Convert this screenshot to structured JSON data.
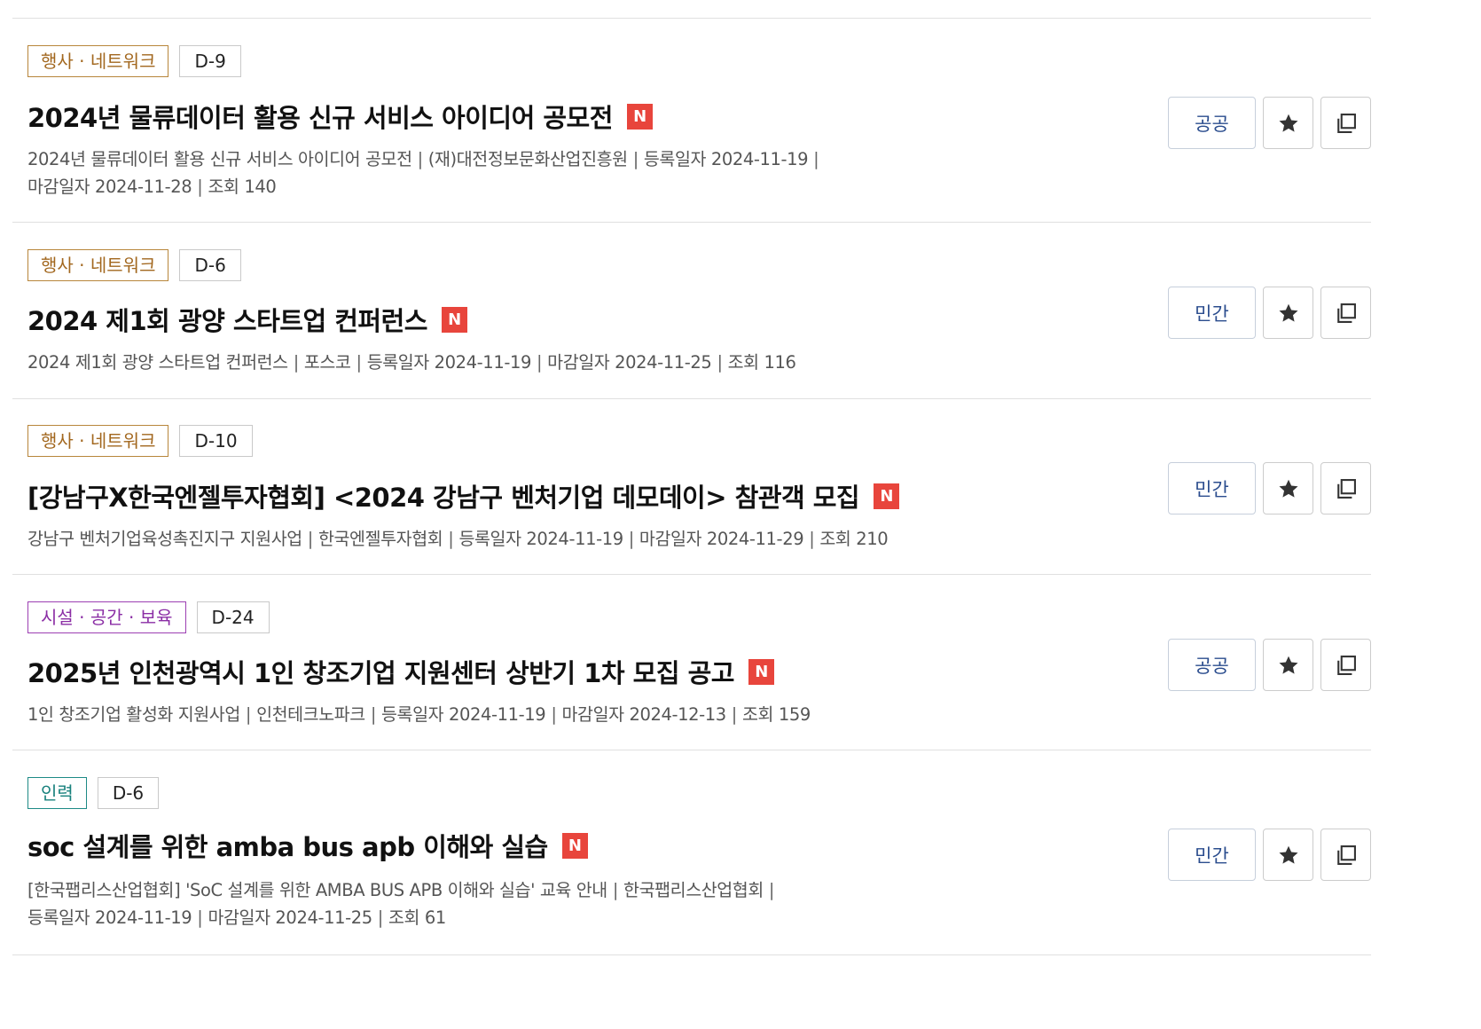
{
  "items": [
    {
      "category": "행사 · 네트워크",
      "dday": "D-9",
      "title": "2024년 물류데이터 활용 신규 서비스 아이디어 공모전",
      "new_badge": "N",
      "meta_line1": [
        "2024년 물류데이터 활용 신규 서비스 아이디어 공모전",
        "(재)대전정보문화산업진흥원",
        "등록일자 2024-11-19",
        ""
      ],
      "meta_line2": [
        "마감일자 2024-11-28",
        "조회 140"
      ],
      "type_label": "공공"
    },
    {
      "category": "행사 · 네트워크",
      "dday": "D-6",
      "title": "2024 제1회 광양 스타트업 컨퍼런스",
      "new_badge": "N",
      "meta_line1": [
        "2024 제1회 광양 스타트업 컨퍼런스",
        "포스코",
        "등록일자 2024-11-19",
        "마감일자 2024-11-25",
        "조회 116"
      ],
      "type_label": "민간"
    },
    {
      "category": "행사 · 네트워크",
      "dday": "D-10",
      "title": "[강남구X한국엔젤투자협회] <2024 강남구 벤처기업 데모데이> 참관객 모집",
      "new_badge": "N",
      "meta_line1": [
        "강남구 벤처기업육성촉진지구 지원사업",
        "한국엔젤투자협회",
        "등록일자 2024-11-19",
        "마감일자 2024-11-29",
        "조회 210"
      ],
      "type_label": "민간"
    },
    {
      "category": "시설 · 공간 · 보육",
      "dday": "D-24",
      "title": "2025년 인천광역시 1인 창조기업 지원센터 상반기 1차 모집 공고",
      "new_badge": "N",
      "meta_line1": [
        "1인 창조기업 활성화 지원사업",
        "인천테크노파크",
        "등록일자 2024-11-19",
        "마감일자 2024-12-13",
        "조회 159"
      ],
      "type_label": "공공"
    },
    {
      "category": "인력",
      "dday": "D-6",
      "title": "soc 설계를 위한 amba bus apb 이해와 실습",
      "new_badge": "N",
      "meta_line1": [
        "[한국팹리스산업협회] 'SoC 설계를 위한 AMBA BUS APB 이해와 실습' 교육 안내",
        "한국팹리스산업협회",
        ""
      ],
      "meta_line2": [
        "등록일자 2024-11-19",
        "마감일자 2024-11-25",
        "조회 61"
      ],
      "type_label": "민간"
    }
  ],
  "icons": {
    "favorite": "star-icon",
    "copy": "copy-icon"
  },
  "colors": {
    "new_badge": "#e8453c",
    "type_text": "#2b4d8e",
    "cat_event": "#a2671e",
    "cat_space": "#8b2ea5",
    "cat_people": "#17807c"
  }
}
